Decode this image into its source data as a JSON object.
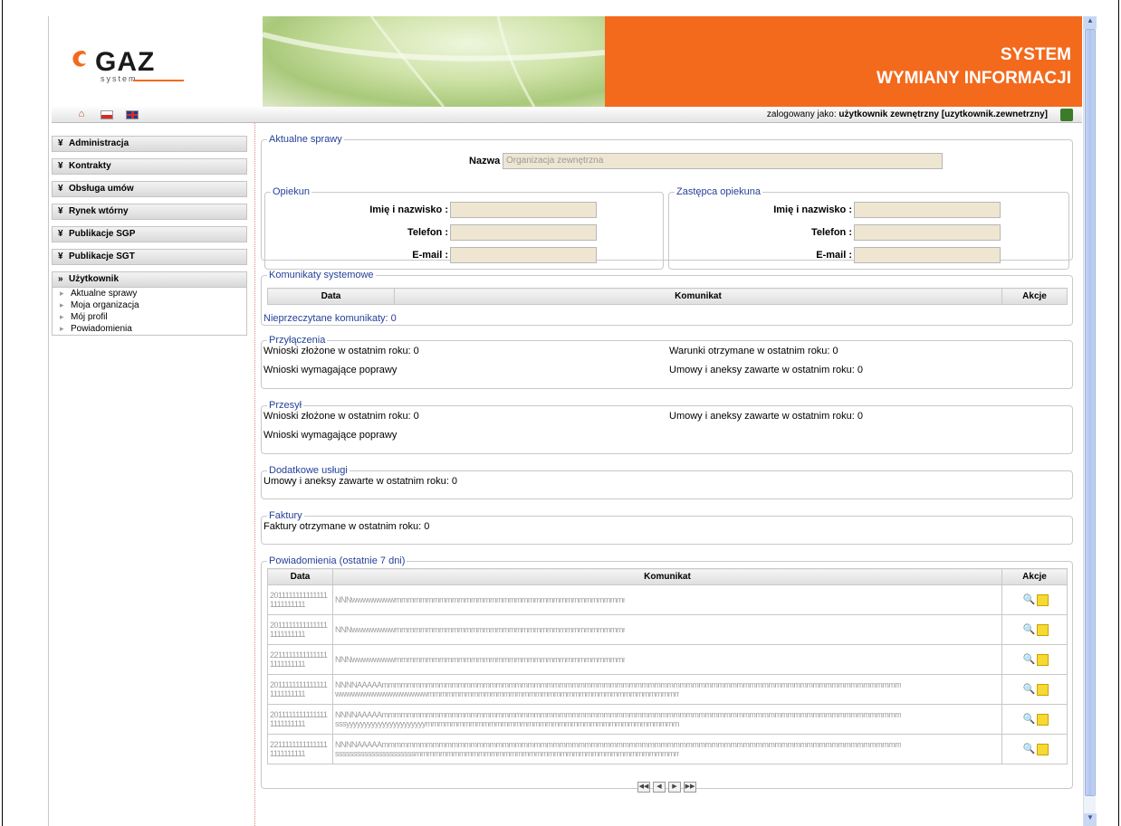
{
  "header": {
    "logo_text": "GAZ",
    "logo_sub": "system",
    "title_line1": "SYSTEM",
    "title_line2": "WYMIANY INFORMACJI"
  },
  "topbar": {
    "home_icon": "home-icon",
    "flag_pl_icon": "flag-pl-icon",
    "flag_uk_icon": "flag-uk-icon",
    "logged_prefix": "zalogowany jako:",
    "logged_user": "użytkownik zewnętrzny [uzytkownik.zewnetrzny]"
  },
  "sidebar": {
    "items": [
      {
        "label": "Administracja",
        "arrow": "»"
      },
      {
        "label": "Kontrakty",
        "arrow": "»"
      },
      {
        "label": "Obsługa umów",
        "arrow": "»"
      },
      {
        "label": "Rynek wtórny",
        "arrow": "»"
      },
      {
        "label": "Publikacje SGP",
        "arrow": "»"
      },
      {
        "label": "Publikacje SGT",
        "arrow": "»"
      },
      {
        "label": "Użytkownik",
        "arrow": "»"
      }
    ],
    "sub_items": [
      "Aktualne sprawy",
      "Moja organizacja",
      "Mój profil",
      "Powiadomienia"
    ]
  },
  "aktualne": {
    "legend": "Aktualne sprawy",
    "nazwa_label": "Nazwa :",
    "nazwa_value": "Organizacja zewnętrzna",
    "opiekun": {
      "legend": "Opiekun",
      "name_label": "Imię i nazwisko :",
      "phone_label": "Telefon :",
      "email_label": "E-mail :"
    },
    "zastepca": {
      "legend": "Zastępca opiekuna",
      "name_label": "Imię i nazwisko :",
      "phone_label": "Telefon :",
      "email_label": "E-mail :"
    }
  },
  "komunikaty": {
    "legend": "Komunikaty systemowe",
    "col_data": "Data",
    "col_komunikat": "Komunikat",
    "col_akcje": "Akcje",
    "unread": "Nieprzeczytane komunikaty: 0"
  },
  "przylaczenia": {
    "legend": "Przyłączenia",
    "left1": "Wnioski złożone w ostatnim roku: 0",
    "left2": "Wnioski wymagające poprawy",
    "right1": "Warunki otrzymane w ostatnim roku: 0",
    "right2": "Umowy i aneksy zawarte w ostatnim roku: 0"
  },
  "przesyl": {
    "legend": "Przesył",
    "left1": "Wnioski złożone w ostatnim roku: 0",
    "left2": "Wnioski wymagające poprawy",
    "right1": "Umowy i aneksy zawarte w ostatnim roku: 0"
  },
  "dodatkowe": {
    "legend": "Dodatkowe usługi",
    "text": "Umowy i aneksy zawarte w ostatnim roku: 0"
  },
  "faktury": {
    "legend": "Faktury",
    "text": "Faktury otrzymane w ostatnim roku: 0"
  },
  "powiadomienia": {
    "legend": "Powiadomienia (ostatnie 7 dni)",
    "col_data": "Data",
    "col_komunikat": "Komunikat",
    "col_akcje": "Akcje",
    "rows": [
      {
        "date1": "2011111111111111",
        "date2": "1111111111",
        "msg1": "NNNwwwwwwwwmmmmmmmmmmmmmmmmmmmmmmmmmmmmmmmmmmmmmmmmm",
        "msg2": ""
      },
      {
        "date1": "2011111111111111",
        "date2": "1111111111",
        "msg1": "NNNwwwwwwwwmmmmmmmmmmmmmmmmmmmmmmmmmmmmmmmmmmmmmmmmm",
        "msg2": ""
      },
      {
        "date1": "2211111111111111",
        "date2": "1111111111",
        "msg1": "NNNwwwwwwwwmmmmmmmmmmmmmmmmmmmmmmmmmmmmmmmmmmmmmmmmm",
        "msg2": ""
      },
      {
        "date1": "2011111111111111",
        "date2": "1111111111",
        "msg1": "NNNNAAAAAmmmmmmmmmmmmmmmmmmmmmmmmmmmmmmmmmmmmmmmmmmmmmmmmmmmmmmmmmmmmmmmmmmmmmmmmmmmmmmmmmmmmmmmmmmmmmmmmmmmmmmmm",
        "msg2": "wwwwwwwwwwwwwwwwwmmmmmmmmmmmmmmmmmmmmmmmmmmmmmmmmmmmmmmmmmmmmmmmmmmm"
      },
      {
        "date1": "2011111111111111",
        "date2": "1111111111",
        "msg1": "NNNNAAAAAmmmmmmmmmmmmmmmmmmmmmmmmmmmmmmmmmmmmmmmmmmmmmmmmmmmmmmmmmmmmmmmmmmmmmmmmmmmmmmmmmmmmmmmmmmmmmmmmmmmmmmmm",
        "msg2": "sssyyyyyyyyyyyyyyyyyyyyyymmmmmmmmmmmmmmmmmmmmmmmmmmmmmmmmmmmmmmmmmm"
      },
      {
        "date1": "2211111111111111",
        "date2": "1111111111",
        "msg1": "NNNNAAAAAmmmmmmmmmmmmmmmmmmmmmmmmmmmmmmmmmmmmmmmmmmmmmmmmmmmmmmmmmmmmmmmmmmmmmmmmmmmmmmmmmmmmmmmmmmmmmmmmmmmmmmmm",
        "msg2": "ssssssssssssssssssssssmmmmmmmmmmmmmmmmmmmmmmmmmmmmmmmmmmmmmmmmmmmmmmm"
      }
    ],
    "pager": [
      "◀◀",
      "◀",
      "▶",
      "▶▶"
    ]
  },
  "colors": {
    "accent_orange": "#f36a1d",
    "link_blue": "#24419a",
    "input_bg": "#efe6d2"
  }
}
